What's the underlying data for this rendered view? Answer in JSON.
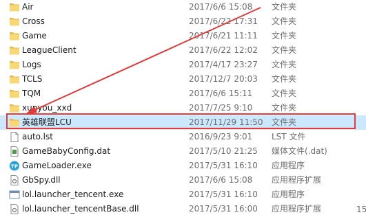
{
  "files": [
    {
      "name": "Air",
      "date": "2017/6/6 15:08",
      "type": "文件夹",
      "icon": "folder-icon"
    },
    {
      "name": "Cross",
      "date": "2017/6/22 17:31",
      "type": "文件夹",
      "icon": "folder-icon"
    },
    {
      "name": "Game",
      "date": "2017/6/21 11:11",
      "type": "文件夹",
      "icon": "folder-icon"
    },
    {
      "name": "LeagueClient",
      "date": "2017/6/22 12:02",
      "type": "文件夹",
      "icon": "folder-icon"
    },
    {
      "name": "Logs",
      "date": "2017/4/17 23:27",
      "type": "文件夹",
      "icon": "folder-icon"
    },
    {
      "name": "TCLS",
      "date": "2017/12/7 20:03",
      "type": "文件夹",
      "icon": "folder-icon"
    },
    {
      "name": "TQM",
      "date": "2017/6/6 15:11",
      "type": "文件夹",
      "icon": "folder-icon"
    },
    {
      "name": "xunyou_xxd",
      "date": "2017/7/25 9:10",
      "type": "文件夹",
      "icon": "folder-icon"
    },
    {
      "name": "英雄联盟LCU",
      "date": "2017/11/29 11:50",
      "type": "文件夹",
      "icon": "folder-icon",
      "selected": true
    },
    {
      "name": "auto.lst",
      "date": "2016/9/23 9:01",
      "type": "LST 文件",
      "icon": "file-icon"
    },
    {
      "name": "GameBabyConfig.dat",
      "date": "2017/5/10 21:25",
      "type": "媒体文件(.dat)",
      "icon": "media-file-icon"
    },
    {
      "name": "GameLoader.exe",
      "date": "2017/5/31 16:10",
      "type": "应用程序",
      "icon": "app-exe-icon"
    },
    {
      "name": "GbSpy.dll",
      "date": "2017/6/6 15:08",
      "type": "应用程序扩展",
      "icon": "dll-icon"
    },
    {
      "name": "lol.launcher_tencent.exe",
      "date": "2017/5/31 16:10",
      "type": "应用程序",
      "icon": "window-exe-icon"
    },
    {
      "name": "lol.launcher_tencentBase.dll",
      "date": "2017/5/31 16:00",
      "type": "应用程序扩展",
      "icon": "dll-icon"
    }
  ],
  "edge_text": "15",
  "annotation": {
    "color": "#e23a3a"
  }
}
